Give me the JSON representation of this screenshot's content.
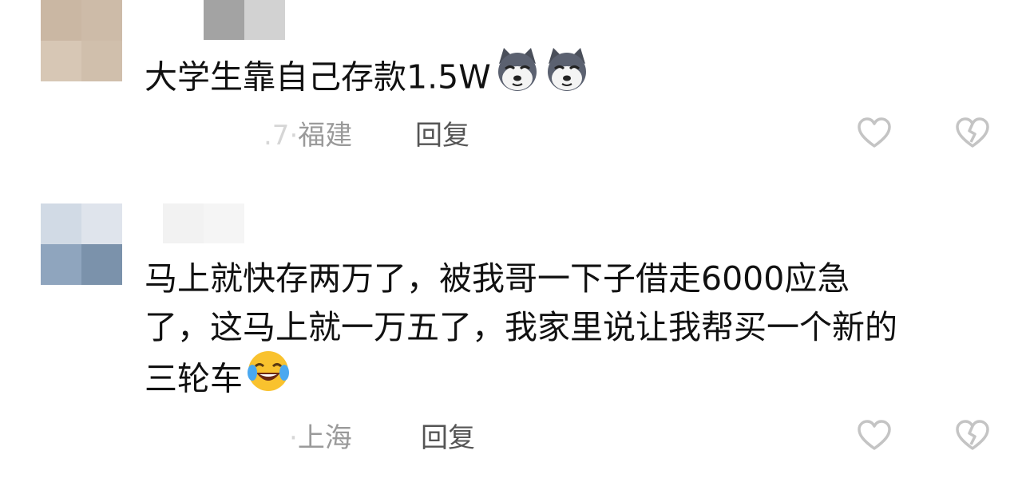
{
  "comments": [
    {
      "text_lines": [
        "大学生靠自己存款1.5W"
      ],
      "emojis": [
        "husky-dog-emoji",
        "husky-dog-emoji"
      ],
      "meta_prefix": "",
      "meta_separator": ".7·",
      "location": "福建",
      "reply_label": "回复",
      "avatar_colors": [
        "#c9b6a3",
        "#cdbca9",
        "#d6c6b4",
        "#cfbfad"
      ],
      "username_colors": [
        "#a0a0a0",
        "#cfcfcf"
      ]
    },
    {
      "text_lines": [
        "马上就快存两万了，被我哥一下子借走6000应急",
        "了，这马上就一万五了，我家里说让我帮买一个新的",
        "三轮车"
      ],
      "emojis": [
        "laughing-crying-emoji"
      ],
      "meta_separator": "·",
      "location": "上海",
      "reply_label": "回复",
      "avatar_colors": [
        "#d0d9e4",
        "#dde2ea",
        "#8ea4bd",
        "#7c93ac"
      ],
      "username_colors": [
        "#f0f0f0",
        "#f4f4f4"
      ]
    }
  ],
  "icons": {
    "like": "heart-outline-icon",
    "dislike": "broken-heart-icon"
  },
  "colors": {
    "text": "#111111",
    "meta": "#9a9a9a",
    "reply": "#555555",
    "icon": "#c4c4c4"
  }
}
